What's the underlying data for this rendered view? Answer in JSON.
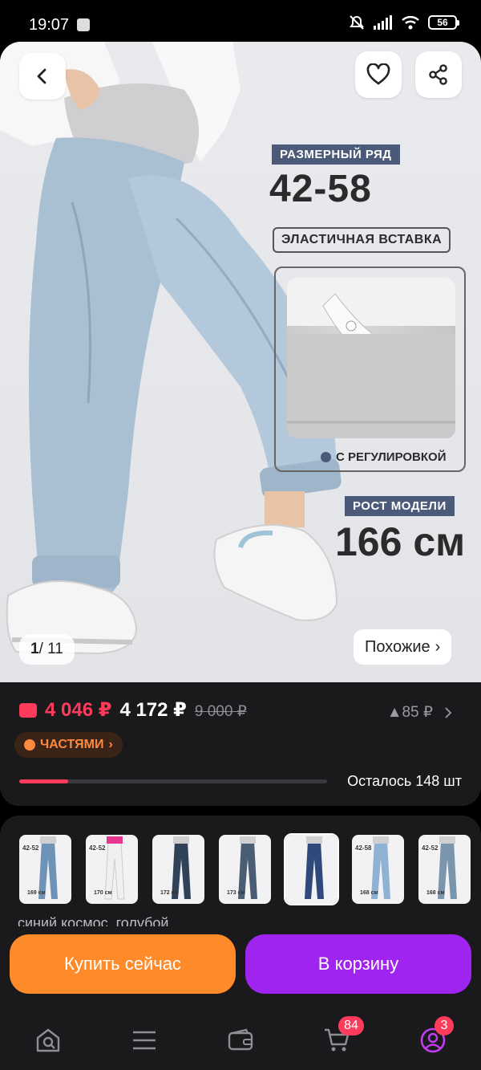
{
  "status_bar": {
    "time": "19:07",
    "battery": "56",
    "icons": [
      "app-icon",
      "mute-alarm-icon",
      "signal-icon",
      "wifi-icon",
      "battery-icon"
    ]
  },
  "hero": {
    "size_tag": "РАЗМЕРНЫЙ РЯД",
    "size_range": "42-58",
    "elastic_tag": "ЭЛАСТИЧНАЯ ВСТАВКА",
    "inset_caption": "С РЕГУЛИРОВКОЙ",
    "model_tag": "РОСТ МОДЕЛИ",
    "model_height": "166 см",
    "counter_current": "1",
    "counter_total": "/ 11",
    "similar_label": "Похожие",
    "similar_chevron": "›"
  },
  "price": {
    "card_price": "4 046 ₽",
    "price": "4 172 ₽",
    "old_price": "9 000 ₽",
    "diff": "▲85 ₽",
    "installments_label": "ЧАСТЯМИ",
    "installments_chevron": "›",
    "stock_text": "Осталось 148 шт",
    "stock_fraction": 0.16
  },
  "variants": {
    "thumbs": [
      {
        "size": "42-52",
        "height": "169 см"
      },
      {
        "size": "42-52",
        "height": "170 см"
      },
      {
        "size": "",
        "height": "172 см"
      },
      {
        "size": "",
        "height": "173 см"
      },
      {
        "size": "",
        "height": ""
      },
      {
        "size": "42-58",
        "height": "168 см"
      },
      {
        "size": "42-52",
        "height": "168 см"
      }
    ],
    "name": "синий космос, голубой"
  },
  "actions": {
    "buy_now": "Купить сейчас",
    "to_cart": "В корзину"
  },
  "nav": {
    "cart_badge": "84",
    "profile_badge": "3"
  },
  "colors": {
    "accent_red": "#ff3b5c",
    "buy_orange": "#ff8a2a",
    "cart_purple": "#a024f0",
    "panel_dark": "#1a1a1c",
    "tag_navy": "#4a5a78"
  }
}
